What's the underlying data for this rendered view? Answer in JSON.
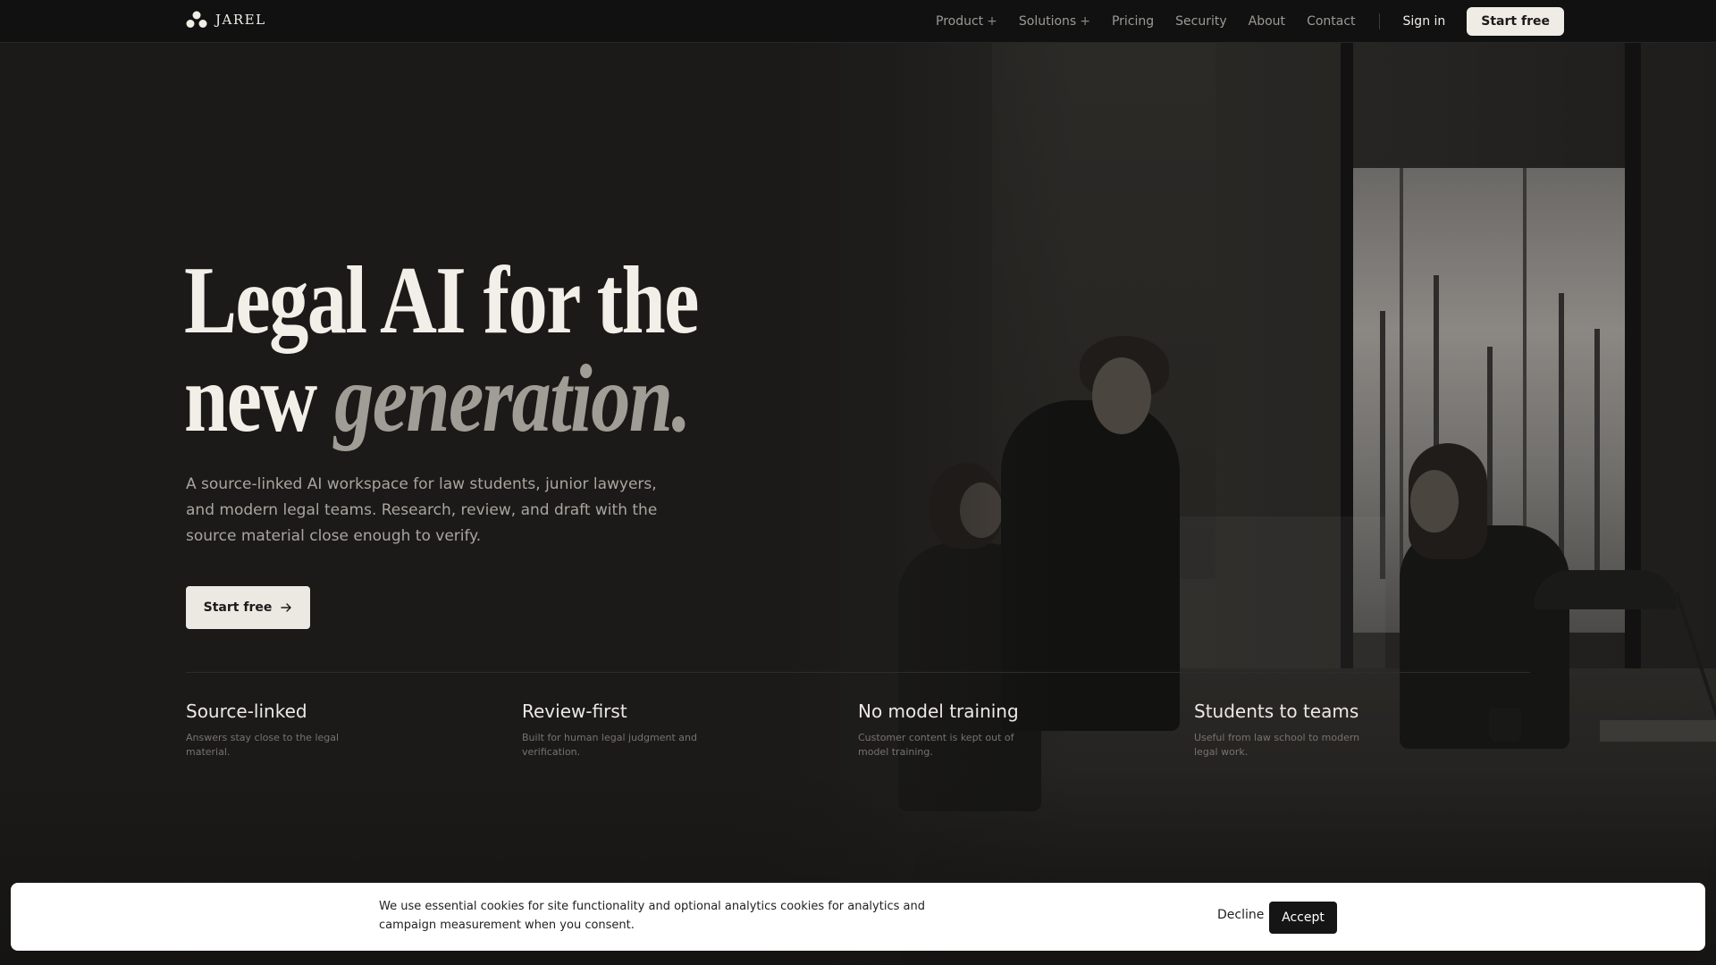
{
  "brand": {
    "name": "JAREL",
    "logo_icon": "three-circle-logo-icon"
  },
  "nav": {
    "items": [
      {
        "label": "Product",
        "expandable": true,
        "suffix": "+"
      },
      {
        "label": "Solutions",
        "expandable": true,
        "suffix": "+"
      },
      {
        "label": "Pricing"
      },
      {
        "label": "Security"
      },
      {
        "label": "About"
      },
      {
        "label": "Contact"
      }
    ],
    "signin_label": "Sign in",
    "start_label": "Start free"
  },
  "hero": {
    "headline_line1": "Legal AI for the",
    "headline_line2_plain": "new ",
    "headline_line2_accent": "generation.",
    "lead": "A source-linked AI workspace for law students, junior lawyers, and modern legal teams. Research, review, and draft with the source material close enough to verify.",
    "cta_label": "Start free",
    "cta_icon": "arrow-right-icon"
  },
  "features": [
    {
      "title": "Source-linked",
      "desc": "Answers stay close to the legal material."
    },
    {
      "title": "Review-first",
      "desc": "Built for human legal judgment and verification."
    },
    {
      "title": "No model training",
      "desc": "Customer content is kept out of model training."
    },
    {
      "title": "Students to teams",
      "desc": "Useful from law school to modern legal work."
    }
  ],
  "cookie": {
    "text": "We use essential cookies for site functionality and optional analytics cookies for analytics and campaign measurement when you consent.",
    "decline_label": "Decline",
    "accept_label": "Accept"
  },
  "colors": {
    "background": "#1b1a18",
    "header": "#111111",
    "text_primary": "#f2efe9",
    "text_muted": "#a9a59f",
    "accent_italic": "#a09c96",
    "button_light": "#ece9e3",
    "button_dark": "#151515"
  }
}
